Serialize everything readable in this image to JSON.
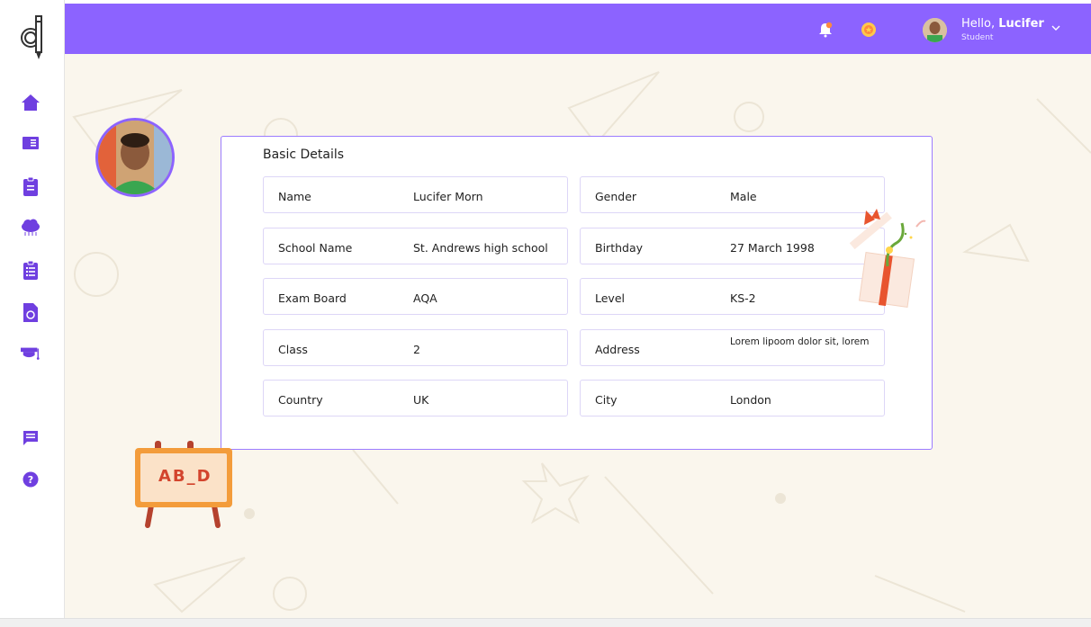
{
  "header": {
    "greeting": "Hello,",
    "user_name": "Lucifer",
    "role": "Student"
  },
  "sidebar": {
    "items": [
      {
        "icon": "home-icon"
      },
      {
        "icon": "book-icon"
      },
      {
        "icon": "clipboard-icon"
      },
      {
        "icon": "cloud-rain-icon"
      },
      {
        "icon": "checklist-icon"
      },
      {
        "icon": "document-icon"
      },
      {
        "icon": "graduation-cap-icon"
      },
      {
        "icon": "chat-icon"
      },
      {
        "icon": "help-icon"
      }
    ]
  },
  "card": {
    "title": "Basic Details",
    "fields": [
      {
        "label": "Name",
        "value": "Lucifer Morn"
      },
      {
        "label": "Gender",
        "value": "Male"
      },
      {
        "label": "School Name",
        "value": "St. Andrews high school"
      },
      {
        "label": "Birthday",
        "value": "27 March 1998"
      },
      {
        "label": "Exam Board",
        "value": "AQA"
      },
      {
        "label": "Level",
        "value": "KS-2"
      },
      {
        "label": "Class",
        "value": "2"
      },
      {
        "label": "Address",
        "value": "Lorem lipoom dolor sit, lorem"
      },
      {
        "label": "Country",
        "value": "UK"
      },
      {
        "label": "City",
        "value": "London"
      }
    ]
  },
  "decorations": {
    "easel_text": "AB_D"
  },
  "colors": {
    "accent": "#8c63ff",
    "icon": "#6f3fe0",
    "background": "#faf6ed"
  }
}
